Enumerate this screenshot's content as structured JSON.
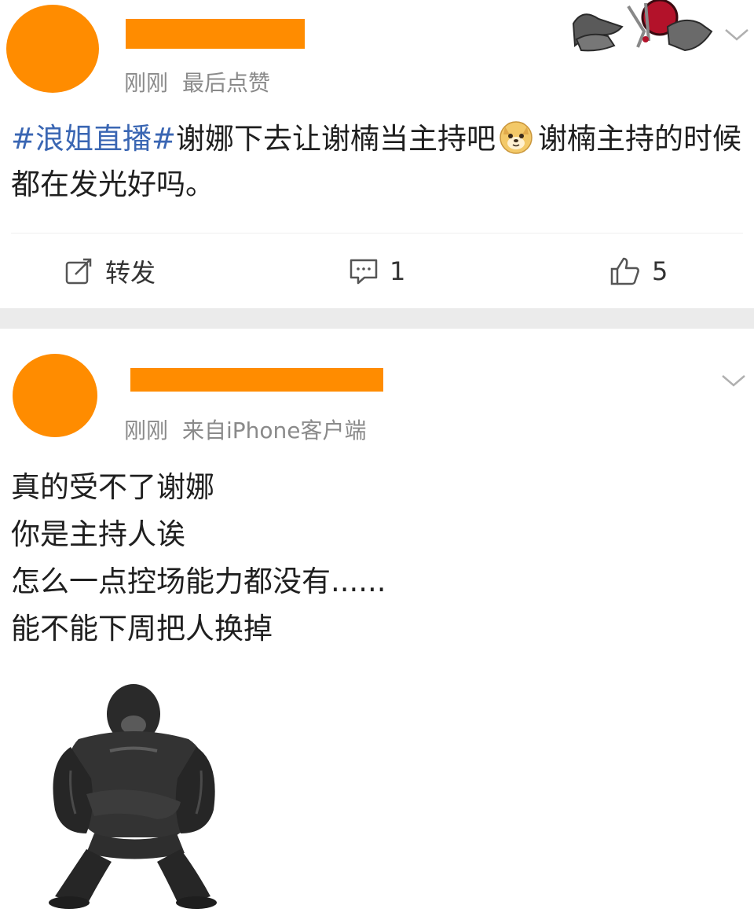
{
  "posts": [
    {
      "username_redacted": true,
      "meta": {
        "time": "刚刚",
        "detail": "最后点赞"
      },
      "content": {
        "hashtag": "#浪姐直播#",
        "text_before_emoji": "谢娜下去让谢楠当主持吧",
        "emoji": "doge",
        "text_after_emoji": "谢楠主持的时候都在发光好吗。"
      },
      "actions": {
        "repost_label": "转发",
        "comment_count": "1",
        "like_count": "5"
      },
      "icons": [
        "share-icon",
        "comment-icon",
        "like-icon",
        "chevron-down-icon"
      ]
    },
    {
      "username_redacted": true,
      "meta": {
        "time": "刚刚",
        "source": "来自iPhone客户端"
      },
      "content_lines": [
        "真的受不了谢娜",
        "你是主持人诶",
        "怎么一点控场能力都没有......",
        "能不能下周把人换掉"
      ],
      "sticker": "gorilla-sticker",
      "icons": [
        "chevron-down-icon"
      ]
    }
  ],
  "colors": {
    "hashtag": "#3a66b3",
    "redaction": "#ff8c00",
    "meta_gray": "#8a8a8a",
    "separator": "#ebebeb"
  }
}
